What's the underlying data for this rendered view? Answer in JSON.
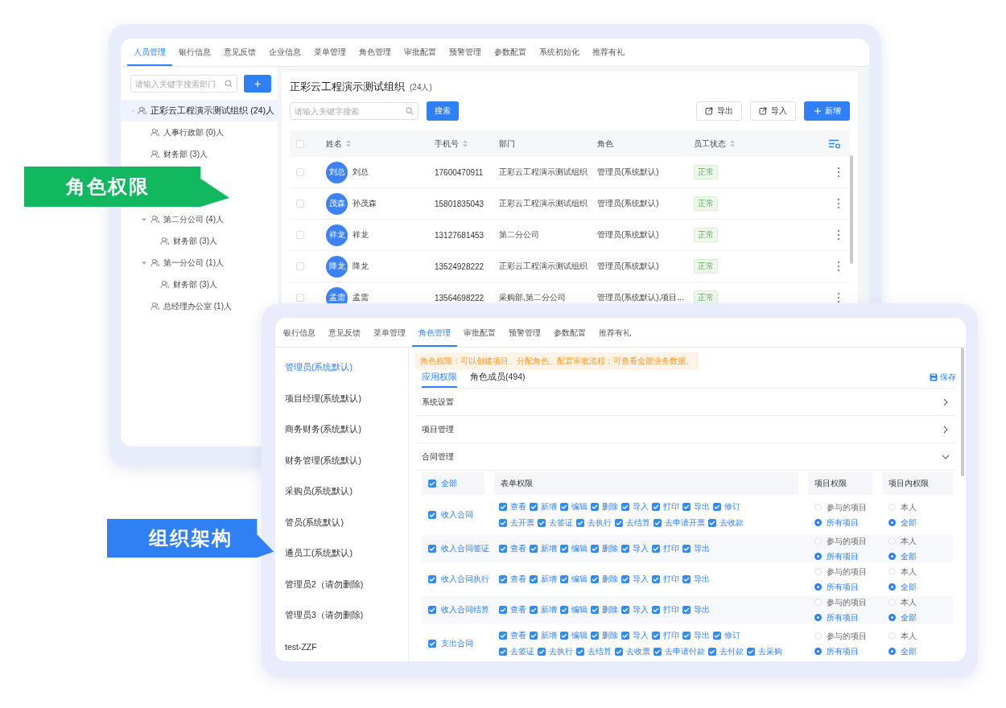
{
  "people_window": {
    "tabs": [
      {
        "label": "人员管理",
        "selected": true
      },
      {
        "label": "银行信息",
        "selected": false
      },
      {
        "label": "意见反馈",
        "selected": false
      },
      {
        "label": "企业信息",
        "selected": false
      },
      {
        "label": "菜单管理",
        "selected": false
      },
      {
        "label": "角色管理",
        "selected": false
      },
      {
        "label": "审批配置",
        "selected": false
      },
      {
        "label": "预警管理",
        "selected": false
      },
      {
        "label": "参数配置",
        "selected": false
      },
      {
        "label": "系统初始化",
        "selected": false
      },
      {
        "label": "推荐有礼",
        "selected": false
      }
    ],
    "dept_search": {
      "placeholder": "请输入关键字搜索部门"
    },
    "add_button": "+",
    "tree": [
      {
        "label": "正彩云工程演示测试组织 (24)人",
        "selected": true,
        "expanded": true,
        "children": [
          {
            "label": "人事行政部 (0)人",
            "selected": false
          },
          {
            "label": "财务部 (3)人",
            "selected": false
          },
          {
            "label": "第二分公司 (4)人",
            "selected": false,
            "expanded": true,
            "children": [
              {
                "label": "财务部 (3)人",
                "selected": false
              }
            ]
          },
          {
            "label": "第一分公司 (1)人",
            "selected": false,
            "expanded": true,
            "children": [
              {
                "label": "财务部 (3)人",
                "selected": false
              }
            ]
          },
          {
            "label": "总经理办公室 (1)人",
            "selected": false
          }
        ]
      }
    ],
    "org_title": "正彩云工程演示测试组织",
    "org_count": "(24人)",
    "search": {
      "placeholder": "请输入关键字搜索"
    },
    "search_button": "搜索",
    "actions": [
      {
        "kind": "export",
        "label": "导出"
      },
      {
        "kind": "import",
        "label": "导入"
      },
      {
        "kind": "add",
        "label": "新增"
      }
    ],
    "table": {
      "all_checked": false,
      "columns": [
        {
          "label": "姓名",
          "sortable": true
        },
        {
          "label": "手机号",
          "sortable": true
        },
        {
          "label": "部门",
          "sortable": false
        },
        {
          "label": "角色",
          "sortable": false
        },
        {
          "label": "员工状态",
          "sortable": true
        }
      ],
      "rows": [
        {
          "checked": false,
          "avatar": "刘总",
          "name": "刘总",
          "phone": "17600470911",
          "dept": "正彩云工程演示测试组织",
          "role": "管理员(系统默认)",
          "status": "正常"
        },
        {
          "checked": false,
          "avatar": "茂森",
          "name": "孙茂森",
          "phone": "15801835043",
          "dept": "正彩云工程演示测试组织",
          "role": "管理员(系统默认)",
          "status": "正常"
        },
        {
          "checked": false,
          "avatar": "祥龙",
          "name": "祥龙",
          "phone": "13127681453",
          "dept": "第二分公司",
          "role": "管理员(系统默认)",
          "status": "正常"
        },
        {
          "checked": false,
          "avatar": "降龙",
          "name": "降龙",
          "phone": "13524928222",
          "dept": "正彩云工程演示测试组织",
          "role": "管理员(系统默认)",
          "status": "正常"
        },
        {
          "checked": false,
          "avatar": "孟需",
          "name": "孟需",
          "phone": "13564698222",
          "dept": "采购部,第二分公司",
          "role": "管理员(系统默认),项目...",
          "status": "正常"
        }
      ]
    }
  },
  "roles_window": {
    "tabs": [
      {
        "label": "银行信息",
        "selected": false
      },
      {
        "label": "意见反馈",
        "selected": false
      },
      {
        "label": "菜单管理",
        "selected": false
      },
      {
        "label": "角色管理",
        "selected": true
      },
      {
        "label": "审批配置",
        "selected": false
      },
      {
        "label": "预警管理",
        "selected": false
      },
      {
        "label": "参数配置",
        "selected": false
      },
      {
        "label": "推荐有礼",
        "selected": false
      }
    ],
    "roles": [
      {
        "label": "管理员(系统默认)",
        "selected": true
      },
      {
        "label": "项目经理(系统默认)",
        "selected": false
      },
      {
        "label": "商务财务(系统默认)",
        "selected": false
      },
      {
        "label": "财务管理(系统默认)",
        "selected": false
      },
      {
        "label": "采购员(系统默认)",
        "selected": false
      },
      {
        "label": "管员(系统默认)",
        "selected": false
      },
      {
        "label": "通员工(系统默认)",
        "selected": false
      },
      {
        "label": "管理员2（请勿删除)",
        "selected": false
      },
      {
        "label": "管理员3（请勿删除)",
        "selected": false
      },
      {
        "label": "test-ZZF",
        "selected": false
      }
    ],
    "notice": "角色权限：可以创建项目、分配角色、配置审批流程；可查看全部业务数据。",
    "subtabs": [
      {
        "label": "应用权限",
        "selected": true
      },
      {
        "label": "角色成员(494)",
        "selected": false
      }
    ],
    "save": "保存",
    "sections": [
      {
        "label": "系统设置",
        "expanded": false
      },
      {
        "label": "项目管理",
        "expanded": false
      },
      {
        "label": "合同管理",
        "expanded": true
      }
    ],
    "grid": {
      "all": {
        "label": "全部",
        "checked": true
      },
      "headers": [
        "表单权限",
        "项目权限",
        "项目内权限"
      ],
      "rows": [
        {
          "name": "收入合同",
          "checked": true,
          "perms": [
            {
              "label": "查看",
              "checked": true
            },
            {
              "label": "新增",
              "checked": true
            },
            {
              "label": "编辑",
              "checked": true
            },
            {
              "label": "删除",
              "checked": true
            },
            {
              "label": "导入",
              "checked": true
            },
            {
              "label": "打印",
              "checked": true
            },
            {
              "label": "导出",
              "checked": true
            },
            {
              "label": "修订",
              "checked": true
            },
            {
              "label": "去开票",
              "checked": true
            },
            {
              "label": "去签证",
              "checked": true
            },
            {
              "label": "去执行",
              "checked": true
            },
            {
              "label": "去结算",
              "checked": true
            },
            {
              "label": "去申请开票",
              "checked": true
            },
            {
              "label": "去收款",
              "checked": true
            }
          ],
          "scope": [
            {
              "label": "参与的项目",
              "selected": false
            },
            {
              "label": "所有项目",
              "selected": true
            }
          ],
          "inner": [
            {
              "label": "本人",
              "selected": false
            },
            {
              "label": "全部",
              "selected": true
            }
          ]
        },
        {
          "name": "收入合同签证",
          "checked": true,
          "perms": [
            {
              "label": "查看",
              "checked": true
            },
            {
              "label": "新增",
              "checked": true
            },
            {
              "label": "编辑",
              "checked": true
            },
            {
              "label": "删除",
              "checked": true
            },
            {
              "label": "导入",
              "checked": true
            },
            {
              "label": "打印",
              "checked": true
            },
            {
              "label": "导出",
              "checked": true
            }
          ],
          "scope": [
            {
              "label": "参与的项目",
              "selected": false
            },
            {
              "label": "所有项目",
              "selected": true
            }
          ],
          "inner": [
            {
              "label": "本人",
              "selected": false
            },
            {
              "label": "全部",
              "selected": true
            }
          ]
        },
        {
          "name": "收入合同执行",
          "checked": true,
          "perms": [
            {
              "label": "查看",
              "checked": true
            },
            {
              "label": "新增",
              "checked": true
            },
            {
              "label": "编辑",
              "checked": true
            },
            {
              "label": "删除",
              "checked": true
            },
            {
              "label": "导入",
              "checked": true
            },
            {
              "label": "打印",
              "checked": true
            },
            {
              "label": "导出",
              "checked": true
            }
          ],
          "scope": [
            {
              "label": "参与的项目",
              "selected": false
            },
            {
              "label": "所有项目",
              "selected": true
            }
          ],
          "inner": [
            {
              "label": "本人",
              "selected": false
            },
            {
              "label": "全部",
              "selected": true
            }
          ]
        },
        {
          "name": "收入合同结算",
          "checked": true,
          "perms": [
            {
              "label": "查看",
              "checked": true
            },
            {
              "label": "新增",
              "checked": true
            },
            {
              "label": "编辑",
              "checked": true
            },
            {
              "label": "删除",
              "checked": true
            },
            {
              "label": "导入",
              "checked": true
            },
            {
              "label": "打印",
              "checked": true
            },
            {
              "label": "导出",
              "checked": true
            }
          ],
          "scope": [
            {
              "label": "参与的项目",
              "selected": false
            },
            {
              "label": "所有项目",
              "selected": true
            }
          ],
          "inner": [
            {
              "label": "本人",
              "selected": false
            },
            {
              "label": "全部",
              "selected": true
            }
          ]
        },
        {
          "name": "支出合同",
          "checked": true,
          "perms": [
            {
              "label": "查看",
              "checked": true
            },
            {
              "label": "新增",
              "checked": true
            },
            {
              "label": "编辑",
              "checked": true
            },
            {
              "label": "删除",
              "checked": true
            },
            {
              "label": "导入",
              "checked": true
            },
            {
              "label": "打印",
              "checked": true
            },
            {
              "label": "导出",
              "checked": true
            },
            {
              "label": "修订",
              "checked": true
            },
            {
              "label": "去签证",
              "checked": true
            },
            {
              "label": "去执行",
              "checked": true
            },
            {
              "label": "去结算",
              "checked": true
            },
            {
              "label": "去收票",
              "checked": true
            },
            {
              "label": "去申请付款",
              "checked": true
            },
            {
              "label": "去付款",
              "checked": true
            },
            {
              "label": "去采购",
              "checked": true
            }
          ],
          "scope": [
            {
              "label": "参与的项目",
              "selected": false
            },
            {
              "label": "所有项目",
              "selected": true
            }
          ],
          "inner": [
            {
              "label": "本人",
              "selected": false
            },
            {
              "label": "全部",
              "selected": true
            }
          ]
        }
      ]
    }
  },
  "callouts": [
    {
      "text": "角色权限",
      "color": "#12b85f"
    },
    {
      "text": "组织架构",
      "color": "#2f7ff5"
    }
  ]
}
